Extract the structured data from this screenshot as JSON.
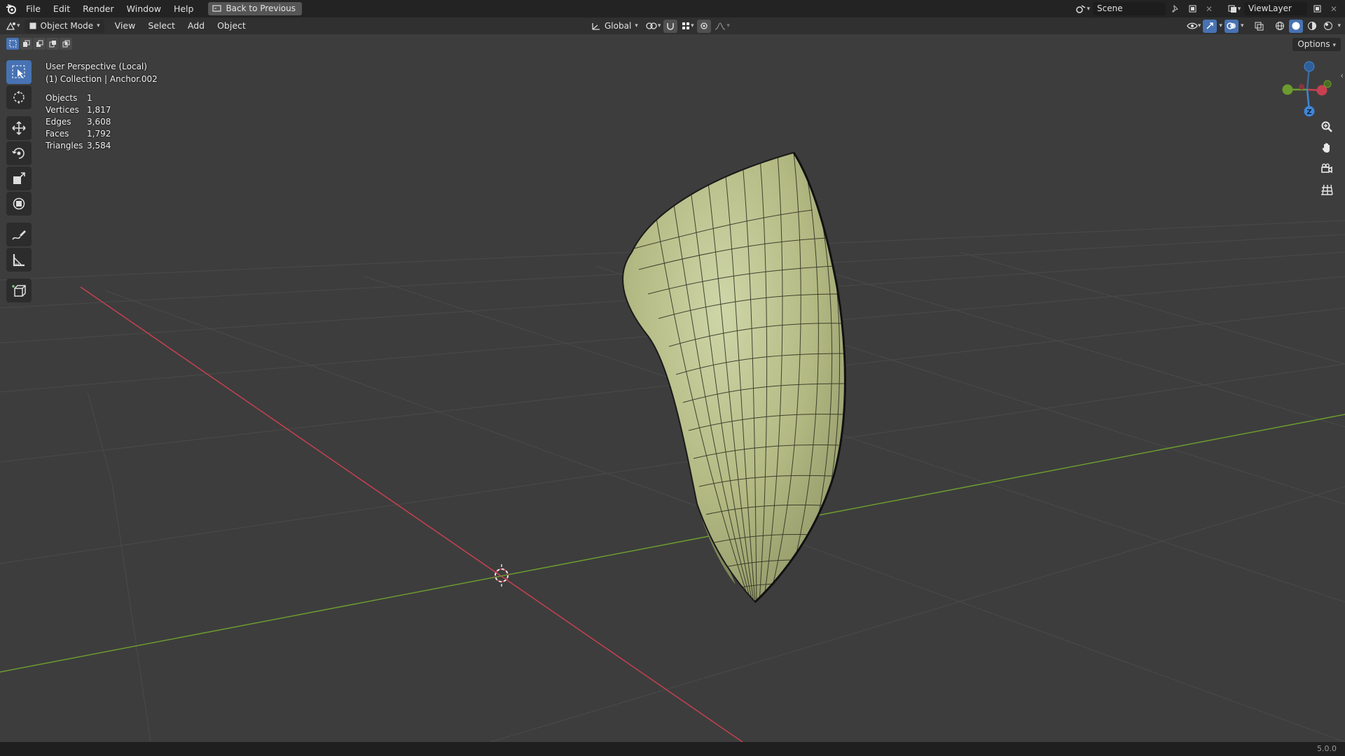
{
  "app": {
    "menu": [
      "File",
      "Edit",
      "Render",
      "Window",
      "Help"
    ],
    "back_button": "Back to Previous",
    "scene": "Scene",
    "view_layer": "ViewLayer",
    "version": "5.0.0"
  },
  "header": {
    "mode": "Object Mode",
    "menus": [
      "View",
      "Select",
      "Add",
      "Object"
    ],
    "orientation": "Global",
    "options": "Options"
  },
  "overlay": {
    "perspective": "User Perspective (Local)",
    "collection": "(1) Collection | Anchor.002",
    "stats": [
      {
        "label": "Objects",
        "value": "1"
      },
      {
        "label": "Vertices",
        "value": "1,817"
      },
      {
        "label": "Edges",
        "value": "3,608"
      },
      {
        "label": "Faces",
        "value": "1,792"
      },
      {
        "label": "Triangles",
        "value": "3,584"
      }
    ]
  },
  "gizmo": {
    "z_label": "Z"
  },
  "colors": {
    "accent": "#4772b3",
    "mesh": "#b7bd8b",
    "x_axis": "#c8404f",
    "y_axis": "#6c9b2f",
    "z_axis": "#3f86d6"
  },
  "icons": [
    "blender-logo-icon",
    "select-box-icon",
    "cursor-icon",
    "move-icon",
    "rotate-icon",
    "scale-icon",
    "transform-icon",
    "annotate-icon",
    "measure-icon",
    "add-cube-icon",
    "zoom-icon",
    "pan-hand-icon",
    "camera-icon",
    "grid-icon"
  ]
}
